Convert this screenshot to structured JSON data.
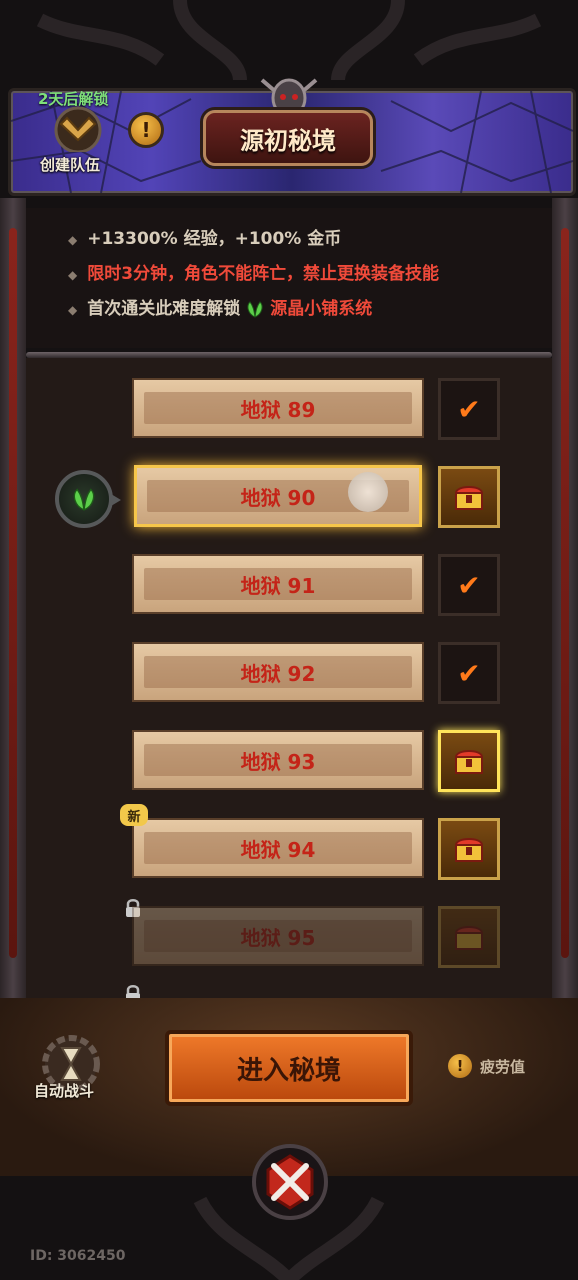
{
  "header": {
    "unlock_days": "2天后解锁",
    "team_label": "创建队伍",
    "title": "源初秘境"
  },
  "info": {
    "line1": "+13300% 经验，+100% 金币",
    "line2": "限时3分钟，角色不能阵亡，禁止更换装备技能",
    "line3_prefix": "首次通关此难度解锁",
    "line3_highlight": "源晶小铺系统"
  },
  "levels": [
    {
      "label": "地狱 89",
      "status": "cleared"
    },
    {
      "label": "地狱 90",
      "status": "selected-reward"
    },
    {
      "label": "地狱 91",
      "status": "cleared"
    },
    {
      "label": "地狱 92",
      "status": "cleared"
    },
    {
      "label": "地狱 93",
      "status": "reward-glow"
    },
    {
      "label": "地狱 94",
      "status": "reward",
      "badge": "新"
    },
    {
      "label": "地狱 95",
      "status": "locked"
    }
  ],
  "bottom": {
    "auto_battle": "自动战斗",
    "enter_button": "进入秘境",
    "fatigue_label": "疲劳值",
    "user_id": "ID: 3062450"
  },
  "colors": {
    "accent_orange": "#f07a2a",
    "warning_red": "#f04a3a",
    "highlight_gold": "#f6c64a",
    "level_text": "#c42418"
  }
}
